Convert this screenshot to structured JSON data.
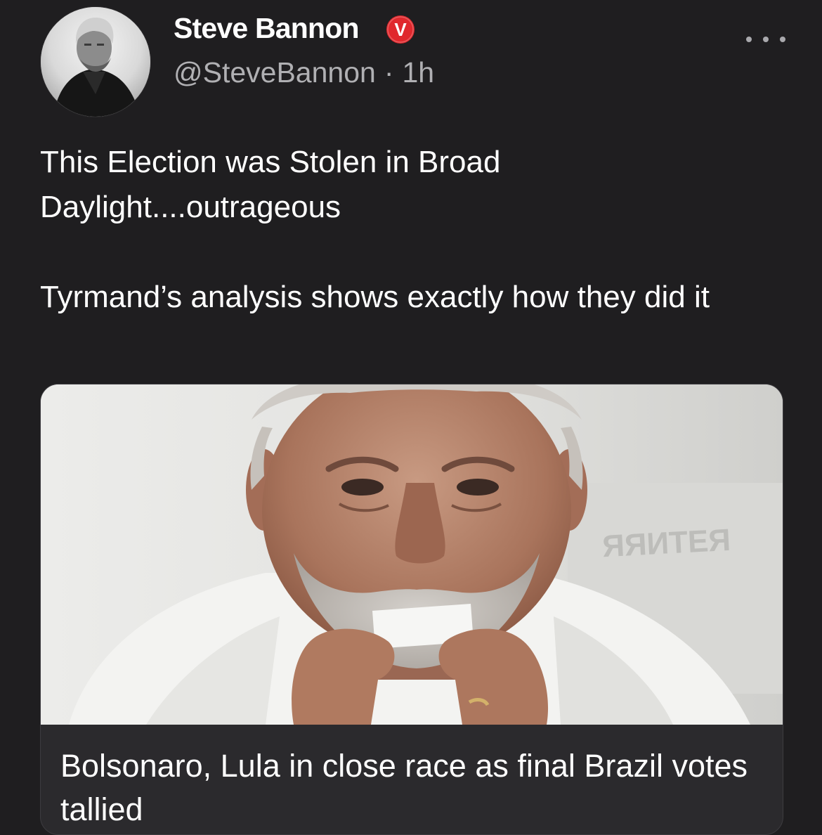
{
  "author": {
    "name": "Steve Bannon",
    "handle": "@SteveBannon",
    "separator": "·",
    "time": "1h",
    "verified_badge_letter": "V",
    "badge_color": "#e0282d"
  },
  "post": {
    "paragraphs": [
      "This Election was Stolen in Broad Daylight....outrageous",
      "Tyrmand’s analysis shows exactly how they did it"
    ]
  },
  "link_card": {
    "title": "Bolsonaro, Lula in close race as final Brazil votes tallied"
  },
  "icons": {
    "more": "more-horizontal-icon",
    "verified": "verified-badge-icon"
  },
  "colors": {
    "background": "#1f1e20",
    "secondary_text": "#b0b0b3",
    "card_border": "#3d3c40"
  }
}
